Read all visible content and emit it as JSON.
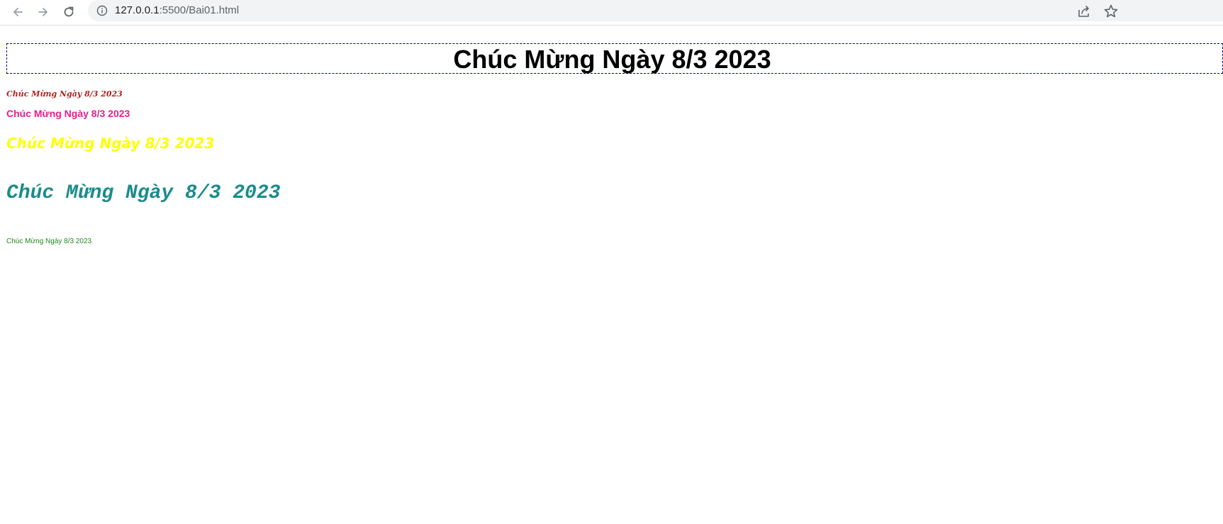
{
  "browser": {
    "url_host": "127.0.0.1",
    "url_path": ":5500/Bai01.html",
    "icons": [
      "back-icon",
      "forward-icon",
      "reload-icon",
      "info-icon",
      "share-icon",
      "bookmark-star-icon"
    ]
  },
  "page": {
    "heading": "Chúc Mừng Ngày 8/3 2023",
    "lines": [
      {
        "text": "Chúc Mừng Ngày 8/3 2023",
        "color": "#b22222"
      },
      {
        "text": "Chúc Mừng Ngày 8/3 2023",
        "color": "#e91e8c"
      },
      {
        "text": "Chúc Mừng Ngày 8/3 2023",
        "color": "#ffff00"
      },
      {
        "text": "Chúc Mừng Ngày 8/3 2023",
        "color": "#1a8c8c"
      },
      {
        "text": "Chúc Mừng Ngày 8/3 2023",
        "color": "#1e8c1e"
      }
    ],
    "heading_border_color": "#00008b"
  }
}
